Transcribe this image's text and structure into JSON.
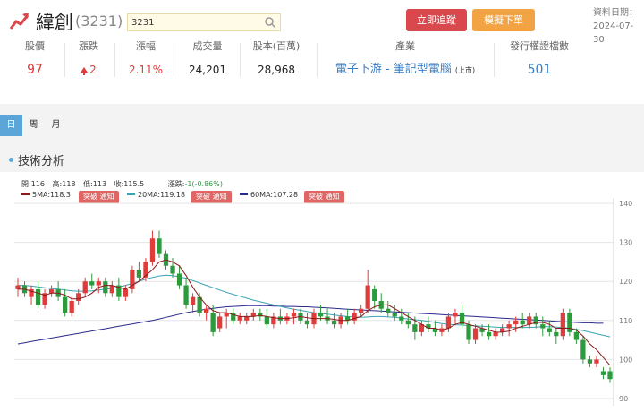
{
  "header": {
    "logo_icon": "rising-chart-icon",
    "name": "緯創",
    "code": "(3231)",
    "search_value": "3231",
    "track_label": "立即追蹤",
    "simulate_label": "模擬下單",
    "date_label": "資料日期：",
    "date_value": "2024-07-30"
  },
  "stats": {
    "price_label": "股價",
    "price_value": "97",
    "change_label": "漲跌",
    "change_value": "2",
    "pct_label": "漲幅",
    "pct_value": "2.11%",
    "volume_label": "成交量",
    "volume_value": "24,201",
    "capital_label": "股本(百萬)",
    "capital_value": "28,968",
    "industry_label": "產業",
    "industry_value": "電子下游 - 筆記型電腦",
    "industry_market": "(上市)",
    "warrants_label": "發行權證檔數",
    "warrants_value": "501"
  },
  "period_tabs": [
    "日",
    "周",
    "月"
  ],
  "section_title": "技術分析",
  "ohlc": {
    "open_label": "開:",
    "open": "116",
    "high_label": "高:",
    "high": "118",
    "low_label": "低:",
    "low": "113",
    "close_label": "收:",
    "close": "115.5",
    "change_label": "漲跌:",
    "change": "-1(-0.86%)"
  },
  "ma": {
    "ma5": "5MA:118.3",
    "ma20": "20MA:119.18",
    "ma60": "60MA:107.28",
    "notify": "突破 通知"
  },
  "colors": {
    "up": "#e03c3c",
    "down": "#2e9a3e",
    "ma5": "#8b1a1a",
    "ma20": "#3aa3b5",
    "ma60": "#2a2a8c",
    "accent_blue": "#5ba5d9"
  },
  "chart_data": {
    "type": "candlestick",
    "y_ticks": [
      140,
      130,
      120,
      110,
      100,
      90
    ],
    "ylim": [
      90,
      140
    ],
    "candles": [
      [
        118,
        121,
        116,
        119
      ],
      [
        119,
        120,
        116,
        117
      ],
      [
        116,
        119,
        114,
        118
      ],
      [
        118,
        120,
        113,
        114
      ],
      [
        114,
        118,
        113,
        117
      ],
      [
        117,
        119,
        116,
        118
      ],
      [
        118,
        120,
        115,
        116
      ],
      [
        116,
        118,
        111,
        112
      ],
      [
        112,
        116,
        111,
        115
      ],
      [
        115,
        118,
        114,
        117
      ],
      [
        117,
        121,
        116,
        120
      ],
      [
        120,
        122,
        118,
        119
      ],
      [
        119,
        121,
        117,
        120
      ],
      [
        120,
        121,
        116,
        117
      ],
      [
        117,
        120,
        116,
        119
      ],
      [
        119,
        121,
        115,
        116
      ],
      [
        116,
        119,
        115,
        118
      ],
      [
        118,
        124,
        117,
        123
      ],
      [
        123,
        125,
        120,
        121
      ],
      [
        121,
        126,
        120,
        125
      ],
      [
        125,
        133,
        124,
        131
      ],
      [
        131,
        133,
        126,
        127
      ],
      [
        127,
        128,
        123,
        124
      ],
      [
        124,
        126,
        121,
        122
      ],
      [
        122,
        124,
        118,
        119
      ],
      [
        119,
        121,
        113,
        114
      ],
      [
        114,
        117,
        112,
        116
      ],
      [
        116,
        117,
        111,
        112
      ],
      [
        112,
        114,
        110,
        113
      ],
      [
        112,
        114,
        106,
        107
      ],
      [
        108,
        112,
        107,
        111
      ],
      [
        111,
        113,
        108,
        112
      ],
      [
        112,
        113,
        109,
        110
      ],
      [
        110,
        112,
        109,
        111
      ],
      [
        110,
        112,
        109,
        111
      ],
      [
        111,
        113,
        110,
        112
      ],
      [
        112,
        113,
        110,
        111
      ],
      [
        111,
        113,
        108,
        109
      ],
      [
        109,
        112,
        108,
        111
      ],
      [
        111,
        113,
        109,
        110
      ],
      [
        110,
        112,
        109,
        111
      ],
      [
        111,
        113,
        109,
        112
      ],
      [
        112,
        113,
        109,
        110
      ],
      [
        110,
        112,
        108,
        109
      ],
      [
        109,
        113,
        108,
        112
      ],
      [
        112,
        114,
        110,
        111
      ],
      [
        111,
        113,
        109,
        110
      ],
      [
        110,
        112,
        108,
        109
      ],
      [
        109,
        112,
        108,
        111
      ],
      [
        111,
        113,
        109,
        110
      ],
      [
        110,
        113,
        109,
        112
      ],
      [
        112,
        114,
        111,
        113
      ],
      [
        113,
        123,
        112,
        119
      ],
      [
        118,
        119,
        113,
        115
      ],
      [
        115,
        117,
        112,
        113
      ],
      [
        113,
        115,
        111,
        112
      ],
      [
        112,
        114,
        110,
        111
      ],
      [
        111,
        113,
        109,
        110
      ],
      [
        110,
        112,
        108,
        109
      ],
      [
        109,
        111,
        105,
        107
      ],
      [
        107,
        110,
        106,
        109
      ],
      [
        109,
        111,
        107,
        108
      ],
      [
        108,
        110,
        106,
        107
      ],
      [
        107,
        109,
        106,
        108
      ],
      [
        108,
        112,
        107,
        111
      ],
      [
        111,
        113,
        109,
        112
      ],
      [
        112,
        114,
        108,
        109
      ],
      [
        109,
        110,
        104,
        105
      ],
      [
        105,
        109,
        104,
        108
      ],
      [
        108,
        109,
        106,
        107
      ],
      [
        107,
        109,
        105,
        106
      ],
      [
        106,
        108,
        105,
        107
      ],
      [
        107,
        109,
        106,
        108
      ],
      [
        108,
        110,
        106,
        109
      ],
      [
        109,
        111,
        107,
        110
      ],
      [
        110,
        112,
        108,
        109
      ],
      [
        109,
        112,
        108,
        111
      ],
      [
        111,
        112,
        108,
        109
      ],
      [
        109,
        111,
        106,
        108
      ],
      [
        108,
        110,
        106,
        107
      ],
      [
        107,
        108,
        104,
        106
      ],
      [
        106,
        113,
        105,
        112
      ],
      [
        112,
        113,
        106,
        107
      ],
      [
        107,
        108,
        104,
        105
      ],
      [
        105,
        106,
        99,
        100
      ],
      [
        100,
        101,
        98,
        99
      ],
      [
        99,
        101,
        98,
        100
      ],
      [
        97,
        98,
        95,
        96
      ],
      [
        97,
        98,
        94,
        95
      ]
    ],
    "ma5": [
      118,
      118,
      117.5,
      117,
      116.5,
      117,
      117,
      116.5,
      115.5,
      115.5,
      116,
      117,
      118.5,
      119,
      119,
      118.5,
      118,
      119,
      120,
      121.5,
      123,
      125,
      125.5,
      125,
      124,
      121.5,
      118.5,
      116,
      114,
      112.5,
      112,
      112,
      111.5,
      111,
      111,
      111,
      111.3,
      111,
      110.7,
      110.5,
      110.5,
      110.7,
      111,
      110.7,
      110.5,
      110.5,
      110.5,
      110.3,
      110,
      110,
      110.5,
      111,
      112.5,
      113.5,
      114,
      114,
      113,
      112,
      111,
      110,
      109,
      108,
      108,
      107.5,
      108,
      109,
      109.5,
      109,
      108.5,
      108,
      107.5,
      107,
      107,
      107.3,
      108,
      108.5,
      109,
      109.5,
      109.5,
      109,
      108,
      108,
      108,
      107.5,
      106,
      104,
      102.5,
      100.5,
      98.5
    ],
    "ma20": [
      119,
      119,
      118.8,
      118.6,
      118.4,
      118.2,
      118,
      117.8,
      117.6,
      117.5,
      117.5,
      117.6,
      117.8,
      118,
      118.2,
      118.6,
      119,
      119.5,
      120,
      120.6,
      121,
      121.4,
      121.6,
      121.5,
      121.2,
      120.8,
      120.2,
      119.6,
      119,
      118.4,
      117.8,
      117.2,
      116.7,
      116.2,
      115.7,
      115.2,
      114.8,
      114.4,
      114,
      113.6,
      113.2,
      112.9,
      112.6,
      112.3,
      112,
      111.8,
      111.6,
      111.4,
      111.2,
      111,
      110.9,
      110.8,
      110.9,
      111,
      111,
      110.9,
      110.8,
      110.6,
      110.4,
      110.2,
      110,
      109.8,
      109.5,
      109.2,
      109,
      108.9,
      108.8,
      108.7,
      108.6,
      108.5,
      108.4,
      108.3,
      108.2,
      108.2,
      108.2,
      108.2,
      108.2,
      108.3,
      108.4,
      108.4,
      108.3,
      108.2,
      108,
      107.7,
      107.4,
      107,
      106.6,
      106.2,
      105.8
    ],
    "ma60": [
      104,
      104.3,
      104.6,
      104.9,
      105.2,
      105.5,
      105.8,
      106.1,
      106.4,
      106.7,
      107,
      107.3,
      107.6,
      107.9,
      108.2,
      108.5,
      108.8,
      109.1,
      109.4,
      109.7,
      110,
      110.4,
      110.8,
      111.2,
      111.6,
      112,
      112.3,
      112.6,
      112.9,
      113.1,
      113.3,
      113.5,
      113.6,
      113.7,
      113.8,
      113.8,
      113.8,
      113.8,
      113.7,
      113.7,
      113.6,
      113.6,
      113.5,
      113.5,
      113.4,
      113.3,
      113.2,
      113.1,
      113,
      112.9,
      112.8,
      112.7,
      112.6,
      112.5,
      112.4,
      112.3,
      112.2,
      112.1,
      112,
      111.9,
      111.8,
      111.7,
      111.6,
      111.5,
      111.4,
      111.3,
      111.2,
      111.1,
      111,
      110.9,
      110.8,
      110.7,
      110.6,
      110.5,
      110.4,
      110.3,
      110.2,
      110.1,
      110,
      109.9,
      109.8,
      109.7,
      109.6,
      109.5,
      109.4,
      109.4,
      109.3,
      109.3
    ]
  }
}
